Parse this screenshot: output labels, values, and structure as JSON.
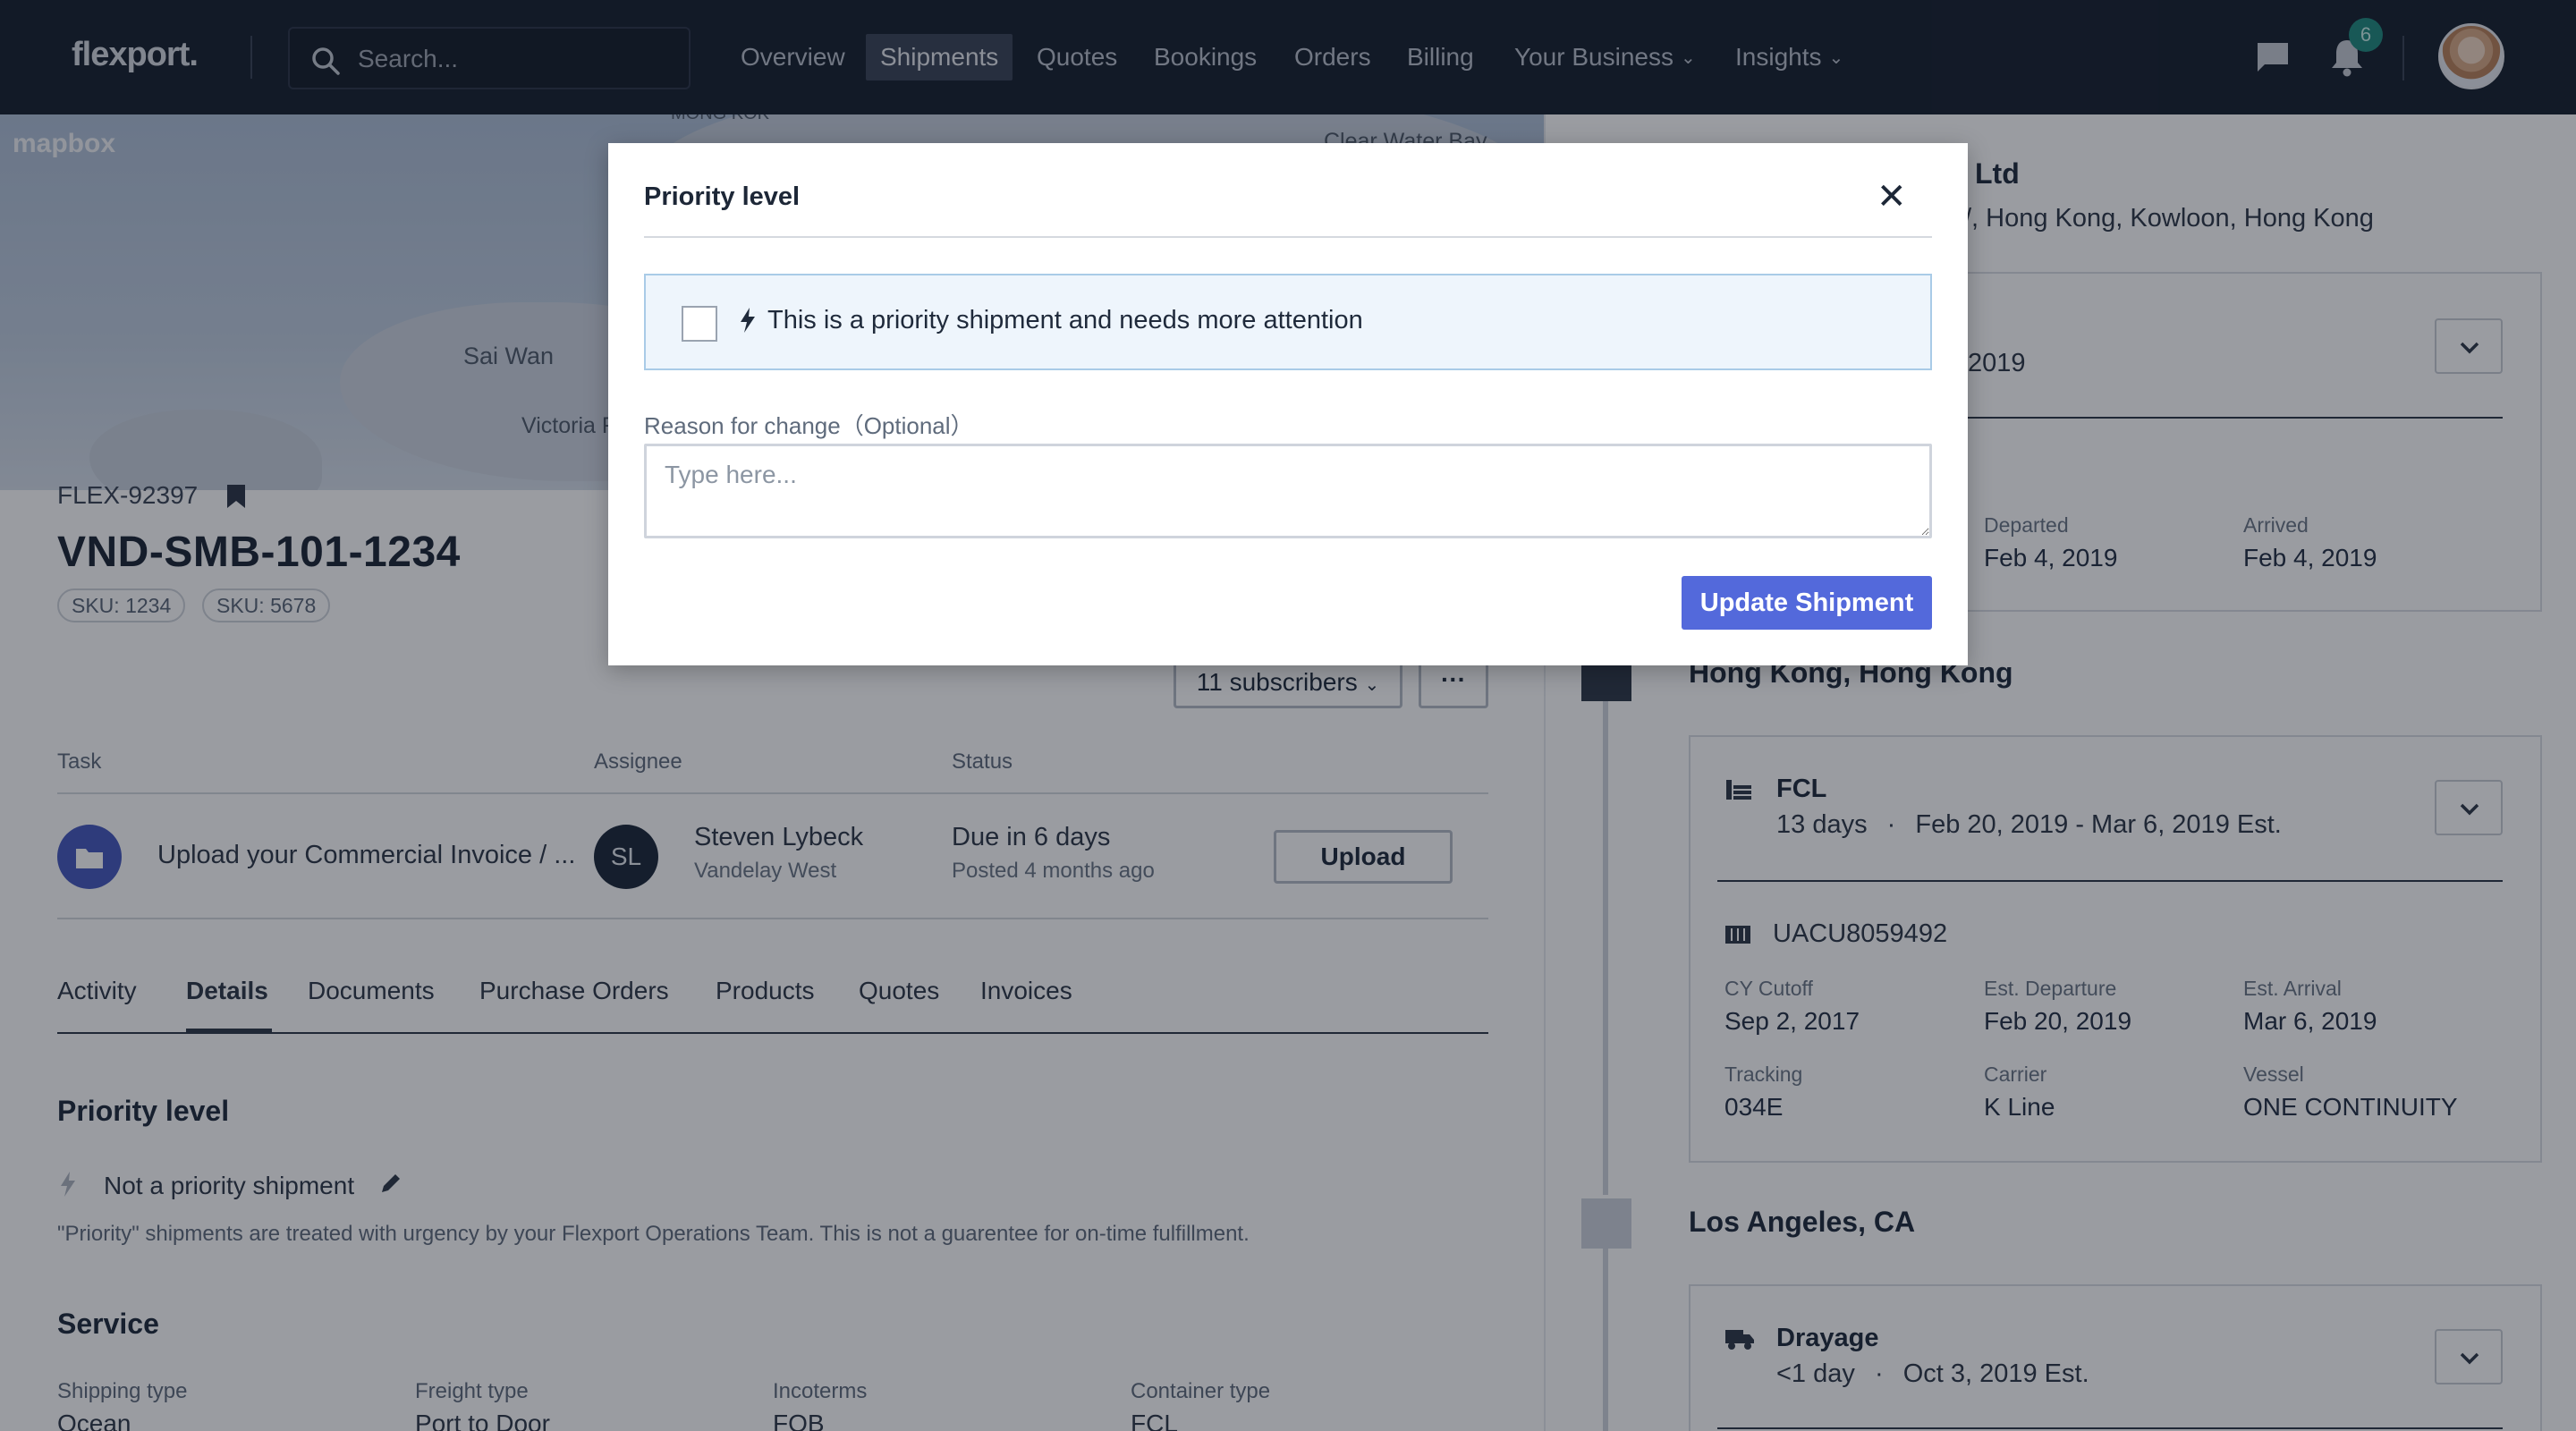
{
  "navbar": {
    "logo": "flexport.",
    "search_placeholder": "Search...",
    "items": [
      "Overview",
      "Shipments",
      "Quotes",
      "Bookings",
      "Orders",
      "Billing",
      "Your Business",
      "Insights"
    ],
    "active_item": "Shipments",
    "notification_count": "6"
  },
  "map": {
    "attribution": "mapbox",
    "labels": [
      "MONG KOK",
      "Clear Water Bay",
      "Sai Wan",
      "Victoria F"
    ]
  },
  "shipment": {
    "flex_id": "FLEX-92397",
    "name": "VND-SMB-101-1234",
    "skus": [
      "SKU: 1234",
      "SKU: 5678"
    ],
    "subscribers": "11 subscribers",
    "more": "···"
  },
  "task_table": {
    "headers": [
      "Task",
      "Assignee",
      "Status"
    ],
    "row": {
      "task": "Upload your Commercial Invoice / ...",
      "assignee_initials": "SL",
      "assignee_name": "Steven Lybeck",
      "assignee_company": "Vandelay West",
      "status": "Due in 6 days",
      "posted": "Posted 4 months ago",
      "action": "Upload"
    }
  },
  "tabs": [
    "Activity",
    "Details",
    "Documents",
    "Purchase Orders",
    "Products",
    "Quotes",
    "Invoices"
  ],
  "active_tab": "Details",
  "priority_section": {
    "heading": "Priority level",
    "value": "Not a priority shipment",
    "note": "\"Priority\" shipments are treated with urgency by your Flexport Operations Team. This is not a guarentee for on-time fulfillment."
  },
  "service_section": {
    "heading": "Service",
    "fields": [
      {
        "label": "Shipping type",
        "value": "Ocean"
      },
      {
        "label": "Freight type",
        "value": "Port to Door"
      },
      {
        "label": "Incoterms",
        "value": "FOB"
      },
      {
        "label": "Container type",
        "value": "FCL"
      }
    ]
  },
  "right_panel": {
    "company_suffix": "Ltd",
    "address_partial": "/, Hong Kong, Kowloon, Hong Kong",
    "top_card": {
      "date_partial": "2019",
      "departed_label": "Departed",
      "departed_value": "Feb 4, 2019",
      "arrived_label": "Arrived",
      "arrived_value": "Feb 4, 2019"
    },
    "location1": "Hong Kong, Hong Kong",
    "fcl_card": {
      "mode": "FCL",
      "duration": "13 days",
      "dates": "Feb 20, 2019 - Mar 6, 2019 Est.",
      "container_id": "UACU8059492",
      "fields": [
        {
          "label": "CY Cutoff",
          "value": "Sep 2, 2017"
        },
        {
          "label": "Est. Departure",
          "value": "Feb 20, 2019"
        },
        {
          "label": "Est. Arrival",
          "value": "Mar 6, 2019"
        },
        {
          "label": "Tracking",
          "value": "034E"
        },
        {
          "label": "Carrier",
          "value": "K Line"
        },
        {
          "label": "Vessel",
          "value": "ONE CONTINUITY"
        }
      ]
    },
    "location2": "Los Angeles, CA",
    "drayage_card": {
      "mode": "Drayage",
      "duration": "<1 day",
      "dates": "Oct 3, 2019 Est."
    }
  },
  "modal": {
    "title": "Priority level",
    "close": "✕",
    "checkbox_label": "This is a priority shipment and needs more attention",
    "reason_label": "Reason for change（Optional）",
    "reason_placeholder": "Type here...",
    "submit": "Update Shipment"
  }
}
